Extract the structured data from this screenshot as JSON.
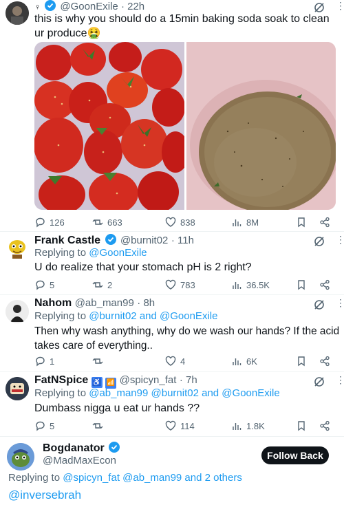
{
  "tweet": {
    "handle": "@GoonExile",
    "time": "22h",
    "text": "this is why you should do a 15min baking soda soak to clean ur produce🤮",
    "replies": "126",
    "retweets": "663",
    "likes": "838",
    "views": "8M"
  },
  "replies": [
    {
      "name": "Frank Castle",
      "handle": "@burnit02",
      "time": "11h",
      "replying_prefix": "Replying to",
      "replying_to": "@GoonExile",
      "text": "U do realize that your stomach pH is 2 right?",
      "replies": "5",
      "retweets": "2",
      "likes": "783",
      "views": "36.5K"
    },
    {
      "name": "Nahom",
      "handle": "@ab_man99",
      "time": "8h",
      "replying_prefix": "Replying to",
      "replying_to": "@burnit02 and @GoonExile",
      "text_line1": "Then why wash anything, why do we wash our hands? If the acid",
      "text_line2": "takes care of everything..",
      "replies": "1",
      "retweets": "",
      "likes": "4",
      "views": "6K"
    },
    {
      "name": "FatNSpice",
      "handle": "@spicyn_fat",
      "time": "7h",
      "replying_prefix": "Replying to",
      "replying_to": "@ab_man99 @burnit02 and @GoonExile",
      "text": "Dumbass nigga u eat ur hands ??",
      "replies": "5",
      "retweets": "",
      "likes": "114",
      "views": "1.8K"
    }
  ],
  "compose": {
    "name": "Bogdanator",
    "handle": "@MadMaxEcon",
    "follow_label": "Follow Back",
    "replying_prefix": "Replying to",
    "replying_to": "@spicyn_fat @ab_man99 and 2 others",
    "mention": "@inversebrah"
  },
  "colors": {
    "accent": "#1d9bf0",
    "text": "#0f1419",
    "muted": "#536471"
  }
}
